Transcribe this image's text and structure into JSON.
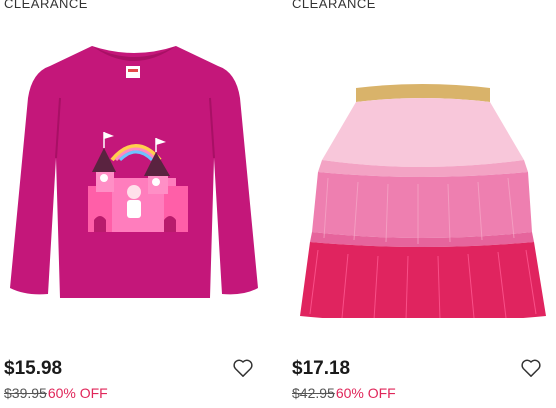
{
  "products": [
    {
      "badge": "CLEARANCE",
      "image_label": "magenta long sleeve castle shirt",
      "price": "$15.98",
      "original_price": "$39.95",
      "discount": "60% OFF"
    },
    {
      "badge": "CLEARANCE",
      "image_label": "pink tiered tutu skirt",
      "price": "$17.18",
      "original_price": "$42.95",
      "discount": "60% OFF"
    }
  ],
  "icons": {
    "wishlist": "heart-outline-icon"
  },
  "colors": {
    "discount": "#e0265a",
    "shirt": "#c4177a",
    "skirt_light": "#f6b8cf",
    "skirt_mid": "#ee7fb0",
    "skirt_dark": "#e0245f",
    "waistband": "#d9b36a"
  }
}
